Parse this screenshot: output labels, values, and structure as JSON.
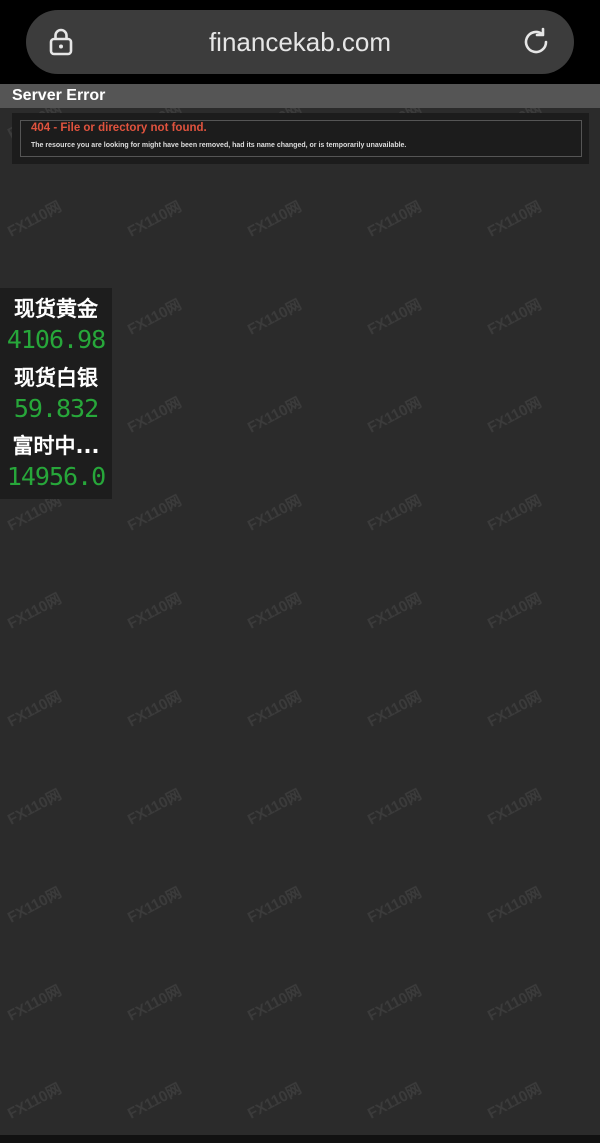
{
  "browser": {
    "url": "financekab.com",
    "lock_icon": "lock-icon",
    "reload_icon": "reload-icon"
  },
  "error_page": {
    "header": "Server Error",
    "title": "404 - File or directory not found.",
    "description": "The resource you are looking for might have been removed, had its name changed, or is temporarily unavailable."
  },
  "quotes": [
    {
      "name": "现货黄金",
      "value": "4106.98"
    },
    {
      "name": "现货白银",
      "value": "59.832"
    },
    {
      "name": "富时中...",
      "value": "14956.0"
    }
  ],
  "watermark": {
    "text": "FX110网"
  },
  "colors": {
    "background": "#2b2b2b",
    "error_red": "#e0533e",
    "quote_green": "#27a73a"
  }
}
